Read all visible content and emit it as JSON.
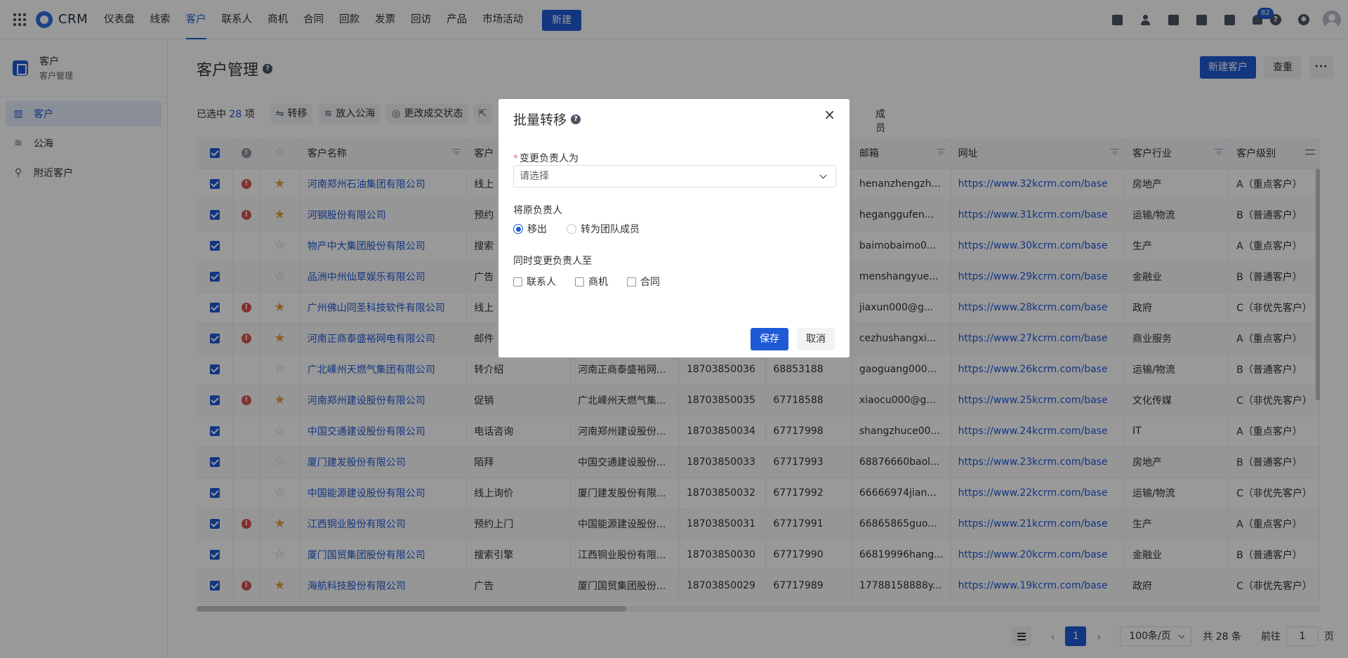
{
  "app": {
    "name": "CRM"
  },
  "nav": {
    "items": [
      "仪表盘",
      "线索",
      "客户",
      "联系人",
      "商机",
      "合同",
      "回款",
      "发票",
      "回访",
      "产品",
      "市场活动"
    ],
    "active_index": 2,
    "new_label": "新建"
  },
  "top_icons": {
    "notification_count": "82",
    "help_glyph": "?"
  },
  "sidebar": {
    "header_title": "客户",
    "header_sub": "客户管理",
    "items": [
      {
        "label": "客户",
        "icon": "customer-icon",
        "glyph": "▥"
      },
      {
        "label": "公海",
        "icon": "sea-icon",
        "glyph": "≋"
      },
      {
        "label": "附近客户",
        "icon": "location-pin-icon",
        "glyph": "⚲"
      }
    ]
  },
  "page": {
    "title": "客户管理",
    "help_glyph": "?",
    "new_customer_label": "新建客户",
    "dedupe_label": "查重",
    "more_label": "···"
  },
  "toolbar": {
    "selected_prefix": "已选中",
    "selected_count": "28",
    "selected_suffix": "项",
    "transfer_label": "转移",
    "to_pool_label": "放入公海",
    "deal_status_label": "更改成交状态",
    "team_member_tail": "成员"
  },
  "table": {
    "headers": {
      "name": "客户名称",
      "source": "客户",
      "email": "邮箱",
      "website": "网址",
      "industry": "客户行业",
      "level": "客户级别"
    },
    "rows": [
      {
        "alert": true,
        "star": true,
        "name": "河南郑州石油集团有限公司",
        "source": "线上",
        "owner": "",
        "mobile": "",
        "phone": "",
        "email": "henanzhengzh...",
        "url": "https://www.32kcrm.com/base",
        "industry": "房地产",
        "level": "A（重点客户）"
      },
      {
        "alert": true,
        "star": true,
        "name": "河钢股份有限公司",
        "source": "预约",
        "owner": "",
        "mobile": "",
        "phone": "",
        "email": "heganggufen...",
        "url": "https://www.31kcrm.com/base",
        "industry": "运输/物流",
        "level": "B（普通客户）"
      },
      {
        "alert": false,
        "star": false,
        "name": "物产中大集团股份有限公司",
        "source": "搜索",
        "owner": "",
        "mobile": "",
        "phone": "",
        "email": "baimobaimo0...",
        "url": "https://www.30kcrm.com/base",
        "industry": "生产",
        "level": "A（重点客户）"
      },
      {
        "alert": false,
        "star": false,
        "name": "品洲中州仙草娱乐有限公司",
        "source": "广告",
        "owner": "",
        "mobile": "",
        "phone": "",
        "email": "menshangyue...",
        "url": "https://www.29kcrm.com/base",
        "industry": "金融业",
        "level": "B（普通客户）"
      },
      {
        "alert": true,
        "star": true,
        "name": "广州佛山同圣科技软件有限公司",
        "source": "线上",
        "owner": "",
        "mobile": "",
        "phone": "",
        "email": "jiaxun000@g...",
        "url": "https://www.28kcrm.com/base",
        "industry": "政府",
        "level": "C（非优先客户）"
      },
      {
        "alert": true,
        "star": true,
        "name": "河南正商泰盛裕网电有限公司",
        "source": "邮件",
        "owner": "",
        "mobile": "",
        "phone": "",
        "email": "cezhushangxi...",
        "url": "https://www.27kcrm.com/base",
        "industry": "商业服务",
        "level": "A（重点客户）"
      },
      {
        "alert": false,
        "star": false,
        "name": "广北嵊州天燃气集团有限公司",
        "source": "转介绍",
        "owner": "河南正商泰盛裕网...",
        "mobile": "18703850036",
        "phone": "68853188",
        "email": "gaoguang000...",
        "url": "https://www.26kcrm.com/base",
        "industry": "运输/物流",
        "level": "B（普通客户）"
      },
      {
        "alert": true,
        "star": true,
        "name": "河南郑州建设股份有限公司",
        "source": "促销",
        "owner": "广北嵊州天燃气集...",
        "mobile": "18703850035",
        "phone": "67718588",
        "email": "xiaocu000@g...",
        "url": "https://www.25kcrm.com/base",
        "industry": "文化传媒",
        "level": "C（非优先客户）"
      },
      {
        "alert": false,
        "star": false,
        "name": "中国交通建设股份有限公司",
        "source": "电话咨询",
        "owner": "河南郑州建设股份...",
        "mobile": "18703850034",
        "phone": "67717998",
        "email": "shangzhuce00...",
        "url": "https://www.24kcrm.com/base",
        "industry": "IT",
        "level": "A（重点客户）"
      },
      {
        "alert": false,
        "star": false,
        "name": "厦门建发股份有限公司",
        "source": "陌拜",
        "owner": "中国交通建设股份...",
        "mobile": "18703850033",
        "phone": "67717993",
        "email": "68876660baol...",
        "url": "https://www.23kcrm.com/base",
        "industry": "房地产",
        "level": "B（普通客户）"
      },
      {
        "alert": false,
        "star": false,
        "name": "中国能源建设股份有限公司",
        "source": "线上询价",
        "owner": "厦门建发股份有限...",
        "mobile": "18703850032",
        "phone": "67717992",
        "email": "66666974jian...",
        "url": "https://www.22kcrm.com/base",
        "industry": "运输/物流",
        "level": "C（非优先客户）"
      },
      {
        "alert": true,
        "star": true,
        "name": "江西铜业股份有限公司",
        "source": "预约上门",
        "owner": "中国能源建设股份...",
        "mobile": "18703850031",
        "phone": "67717991",
        "email": "66865865guo...",
        "url": "https://www.21kcrm.com/base",
        "industry": "生产",
        "level": "A（重点客户）"
      },
      {
        "alert": false,
        "star": false,
        "name": "厦门国贸集团股份有限公司",
        "source": "搜索引擎",
        "owner": "江西铜业股份有限...",
        "mobile": "18703850030",
        "phone": "67717990",
        "email": "66819996hang...",
        "url": "https://www.20kcrm.com/base",
        "industry": "金融业",
        "level": "B（普通客户）"
      },
      {
        "alert": true,
        "star": true,
        "name": "海航科技股份有限公司",
        "source": "广告",
        "owner": "厦门国贸集团股份...",
        "mobile": "18703850029",
        "phone": "67717989",
        "email": "17788158888y...",
        "url": "https://www.19kcrm.com/base",
        "industry": "政府",
        "level": "C（非优先客户）"
      }
    ]
  },
  "pagination": {
    "current_page": "1",
    "page_size": "100条/页",
    "total": "共 28 条",
    "goto_prefix": "前往",
    "goto_value": "1",
    "goto_suffix": "页"
  },
  "modal": {
    "title": "批量转移",
    "help_glyph": "?",
    "close_glyph": "×",
    "owner_label": "变更负责人为",
    "owner_required_mark": "*",
    "owner_placeholder": "请选择",
    "original_owner_label": "将原负责人",
    "radio_remove": "移出",
    "radio_to_team": "转为团队成员",
    "also_change_label": "同时变更负责人至",
    "check_contact": "联系人",
    "check_business": "商机",
    "check_contract": "合同",
    "save_label": "保存",
    "cancel_label": "取消"
  },
  "colors": {
    "primary": "#1e5ad6",
    "star": "#e6a23c",
    "alert": "#d9534f",
    "overlay": "rgba(0,0,0,0.4)"
  }
}
